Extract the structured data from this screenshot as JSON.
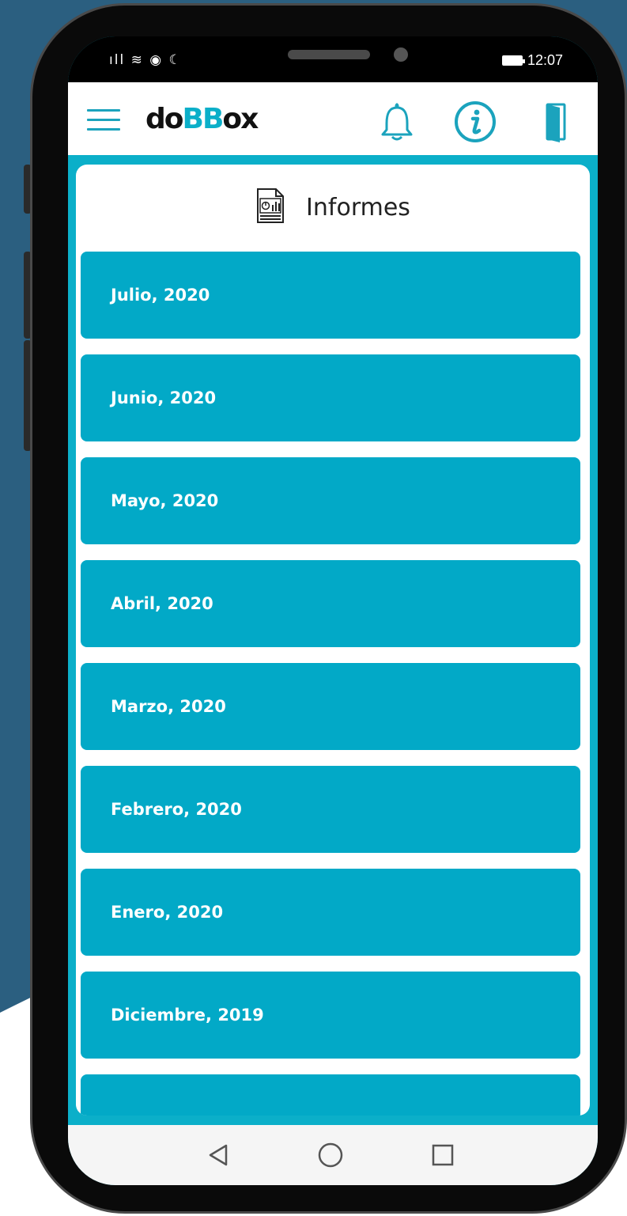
{
  "status_bar": {
    "left_icons": "ıll ≋ ◉ ☾",
    "time": "12:07"
  },
  "app_bar": {
    "logo_prefix": "do",
    "logo_b1": "B",
    "logo_b2": "B",
    "logo_suffix": "ox",
    "icons": [
      "menu-icon",
      "bell-icon",
      "info-icon",
      "door-icon"
    ]
  },
  "page": {
    "title": "Informes",
    "title_icon": "report-document-icon"
  },
  "months": [
    {
      "label": "Julio, 2020"
    },
    {
      "label": "Junio, 2020"
    },
    {
      "label": "Mayo, 2020"
    },
    {
      "label": "Abril, 2020"
    },
    {
      "label": "Marzo, 2020"
    },
    {
      "label": "Febrero, 2020"
    },
    {
      "label": "Enero, 2020"
    },
    {
      "label": "Diciembre, 2019"
    },
    {
      "label": ""
    }
  ],
  "nav_bar": {
    "icons": [
      "back-triangle-icon",
      "home-circle-icon",
      "recents-square-icon"
    ]
  },
  "colors": {
    "accent": "#0bafc9",
    "item_bg": "#02a9c7",
    "bg_shape": "#2b5f80"
  }
}
